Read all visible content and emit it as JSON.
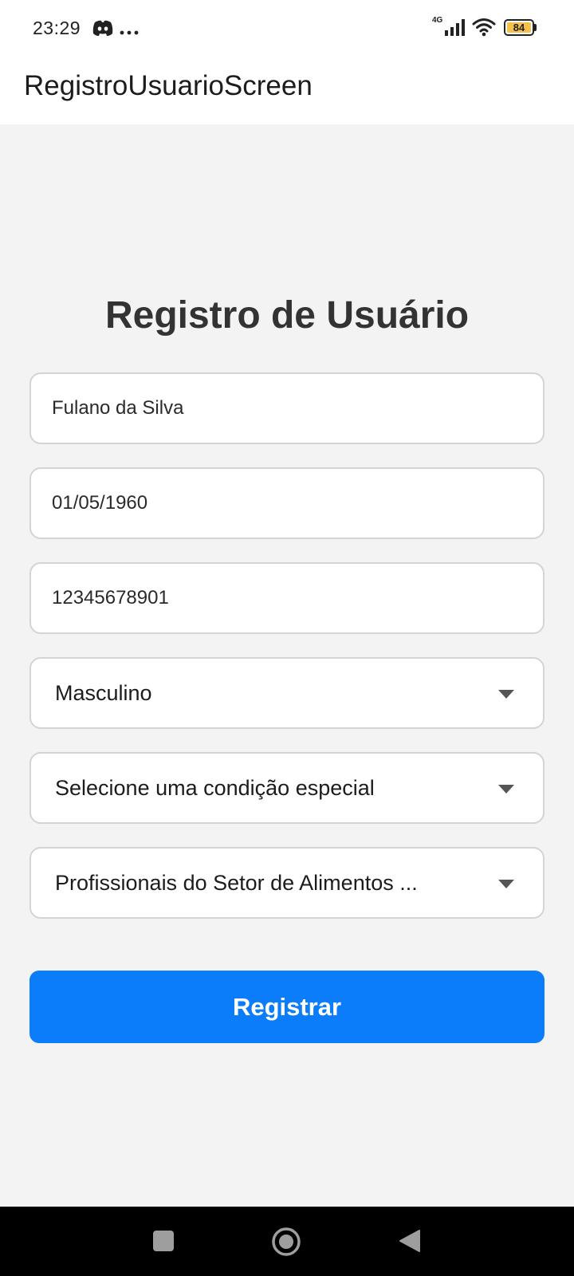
{
  "status_bar": {
    "time": "23:29",
    "network": "4G",
    "battery": "84",
    "icons": [
      "discord-icon",
      "more-icon",
      "signal-icon",
      "wifi-icon",
      "battery-icon"
    ]
  },
  "app_bar": {
    "title": "RegistroUsuarioScreen"
  },
  "form": {
    "heading": "Registro de Usuário",
    "name_value": "Fulano da Silva",
    "birthdate_value": "01/05/1960",
    "cpf_value": "12345678901",
    "gender_selected": "Masculino",
    "condition_selected": "Selecione uma condição especial",
    "group_selected": "Profissionais do Setor de Alimentos ...",
    "submit_label": "Registrar"
  },
  "colors": {
    "accent": "#0b7dfb",
    "background": "#f3f3f3",
    "battery": "#f4c14d"
  },
  "nav_bar": {
    "icons": [
      "recents-icon",
      "home-icon",
      "back-icon"
    ]
  }
}
